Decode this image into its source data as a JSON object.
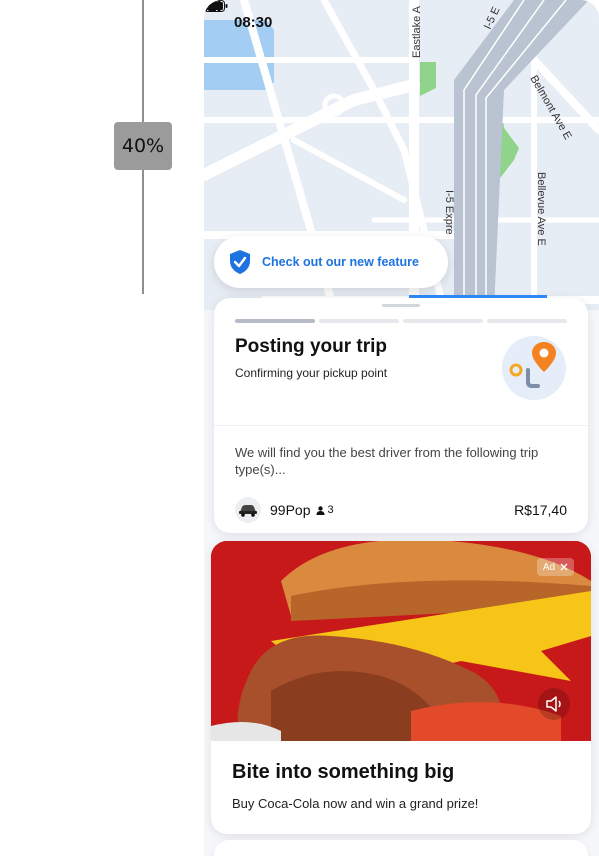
{
  "zoom_indicator": {
    "label": "40%"
  },
  "status_bar": {
    "time": "08:30",
    "icons": [
      "signal-icon",
      "wifi-icon",
      "battery-icon"
    ]
  },
  "map": {
    "street_labels": [
      "Eastlake A",
      "I-5 E",
      "Belmont Ave E",
      "I-5 Expre",
      "Bellevue Ave E"
    ]
  },
  "feature_banner": {
    "label": "Check out our new feature",
    "icon": "shield-check-icon",
    "accent_color": "#1f73e0"
  },
  "trip_card": {
    "title": "Posting your trip",
    "subtitle": "Confirming your pickup point",
    "description": "We will find you the best driver from the following trip type(s)...",
    "option": {
      "name": "99Pop",
      "seats": "3",
      "price": "R$17,40"
    }
  },
  "ad": {
    "badge": "Ad",
    "title": "Bite into something big",
    "subtitle": "Buy Coca-Cola now and win a grand prize!",
    "image_bg_color": "#c8191a"
  }
}
